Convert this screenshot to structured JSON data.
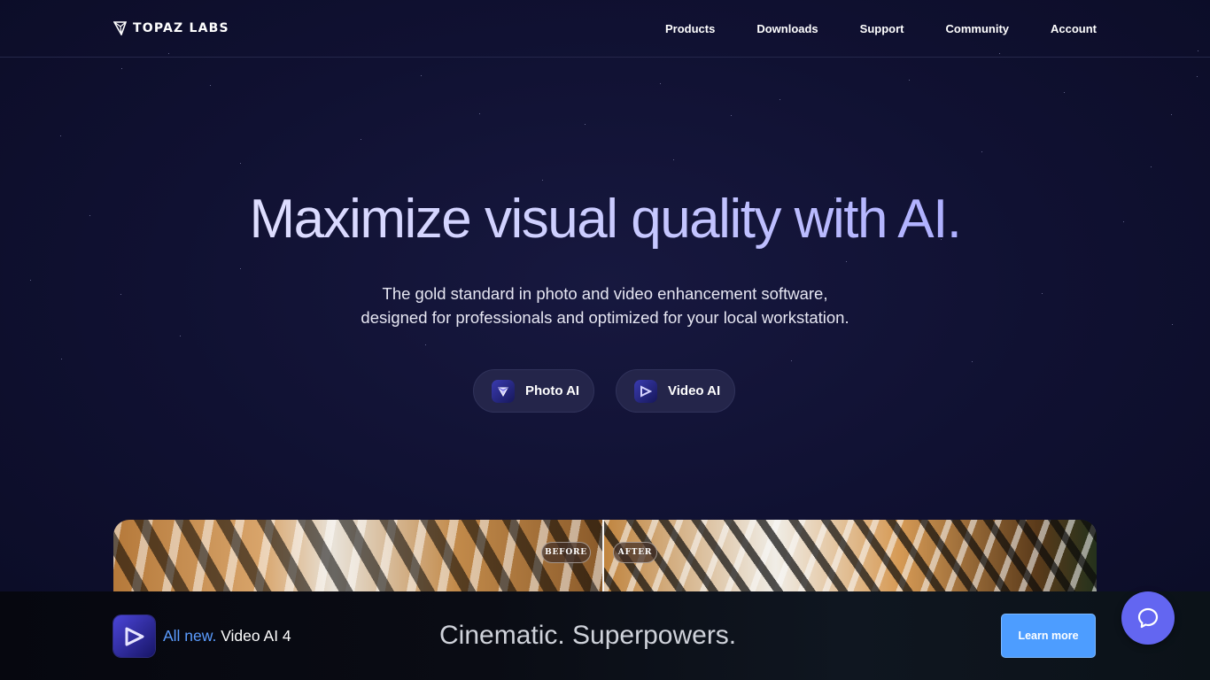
{
  "header": {
    "logo_text": "TOPAZ LABS",
    "nav": [
      "Products",
      "Downloads",
      "Support",
      "Community",
      "Account"
    ]
  },
  "hero": {
    "title": "Maximize visual quality with AI.",
    "subtitle_line1": "The gold standard in photo and video enhancement software,",
    "subtitle_line2": "designed for professionals and optimized for your local workstation.",
    "buttons": [
      {
        "label": "Photo AI",
        "icon": "photo-ai-icon"
      },
      {
        "label": "Video AI",
        "icon": "video-ai-icon"
      }
    ]
  },
  "comparison": {
    "before_label": "BEFORE",
    "after_label": "AFTER"
  },
  "promo": {
    "highlight": "All new.",
    "product": "Video AI 4",
    "tagline": "Cinematic. Superpowers.",
    "button": "Learn more"
  },
  "colors": {
    "background": "#0d0e2b",
    "accent": "#6366f1",
    "promo_highlight": "#5b9cff",
    "learn_button": "#4d9dff"
  }
}
